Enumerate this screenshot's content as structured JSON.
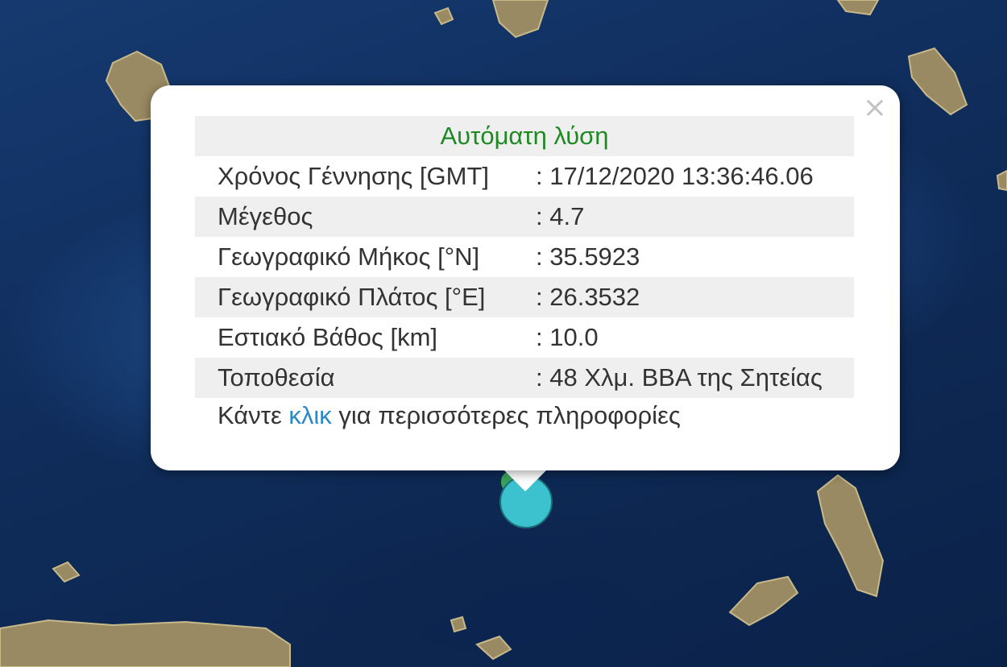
{
  "popup": {
    "close_symbol": "×",
    "title": "Αυτόματη λύση",
    "rows": [
      {
        "label": "Χρόνος Γέννησης [GMT]",
        "value": ": 17/12/2020 13:36:46.06"
      },
      {
        "label": "Μέγεθος",
        "value": ": 4.7"
      },
      {
        "label": "Γεωγραφικό Μήκος [°N]",
        "value": ": 35.5923"
      },
      {
        "label": "Γεωγραφικό Πλάτος [°E]",
        "value": ": 26.3532"
      },
      {
        "label": "Εστιακό Βάθος [km]",
        "value": ": 10.0"
      },
      {
        "label": "Τοποθεσία",
        "value": ": 48 Χλμ. ΒΒΑ της Σητείας"
      }
    ],
    "more_prefix": "Κάντε ",
    "more_link": "κλικ",
    "more_suffix": " για περισσότερες πληροφορίες"
  },
  "map": {
    "marker_color": "#3cc1cf",
    "marker_secondary_color": "#3aa35a"
  }
}
